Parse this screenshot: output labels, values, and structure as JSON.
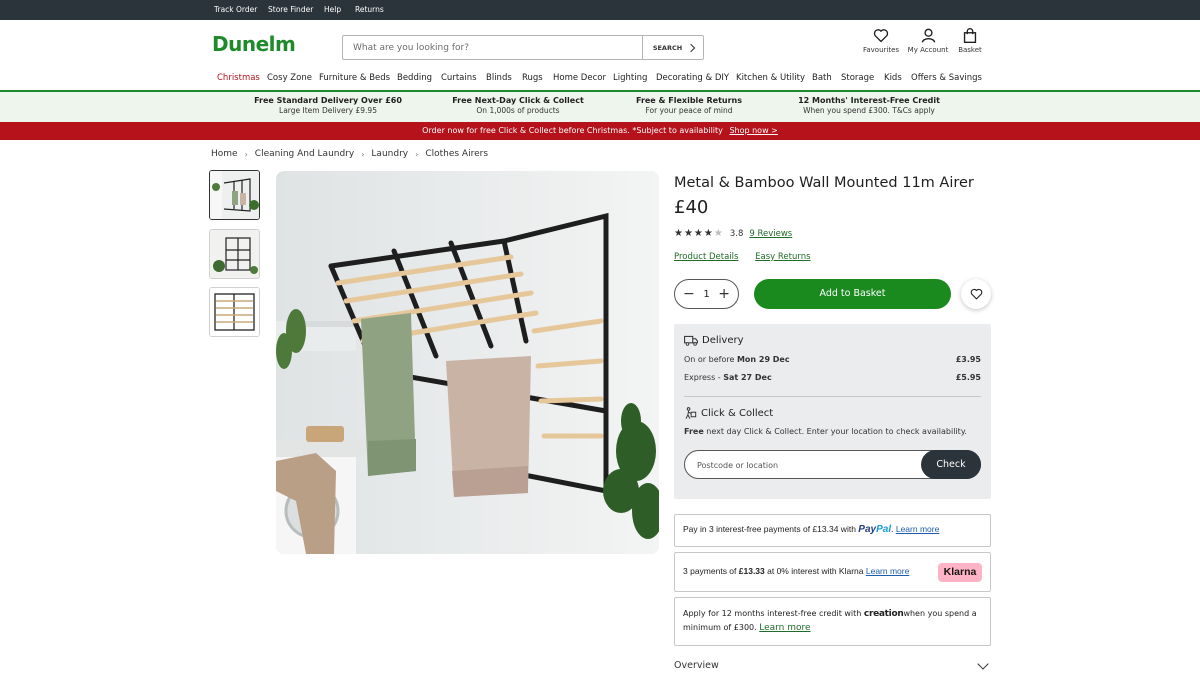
{
  "utility": {
    "links": [
      "Track Order",
      "Store Finder",
      "Help",
      "Returns"
    ]
  },
  "header": {
    "logo": "Dunelm",
    "search_placeholder": "What are you looking for?",
    "search_button": "SEARCH",
    "favourites": "Favourites",
    "account": "My Account",
    "basket": "Basket"
  },
  "nav": {
    "items": [
      "Christmas",
      "Cosy Zone",
      "Furniture & Beds",
      "Bedding",
      "Curtains",
      "Blinds",
      "Rugs",
      "Home Decor",
      "Lighting",
      "Decorating & DIY",
      "Kitchen & Utility",
      "Bath",
      "Storage",
      "Kids",
      "Offers & Savings"
    ]
  },
  "usps": [
    {
      "title": "Free Standard Delivery Over £60",
      "sub": "Large Item Delivery £9.95"
    },
    {
      "title": "Free Next-Day Click & Collect",
      "sub": "On 1,000s of products"
    },
    {
      "title": "Free & Flexible Returns",
      "sub": "For your peace of mind"
    },
    {
      "title": "12 Months' Interest-Free Credit",
      "sub": "When you spend £300. T&Cs apply"
    }
  ],
  "promo": {
    "text": "Order now for free Click & Collect before Christmas. *Subject to availability",
    "link": "Shop now >"
  },
  "breadcrumb": [
    "Home",
    "Cleaning And Laundry",
    "Laundry",
    "Clothes Airers"
  ],
  "product": {
    "title": "Metal & Bamboo Wall Mounted 11m Airer",
    "price": "£40",
    "rating": 3.8,
    "rating_text": "3.8",
    "reviews": "9 Reviews",
    "links": [
      "Product Details",
      "Easy Returns"
    ],
    "quantity": "1",
    "add_button": "Add to Basket"
  },
  "delivery": {
    "heading": "Delivery",
    "rows": [
      {
        "label": "On or before ",
        "date": "Mon 29 Dec",
        "price": "£3.95"
      },
      {
        "label": "Express - ",
        "date": "Sat 27 Dec",
        "price": "£5.95"
      }
    ],
    "cc_heading": "Click & Collect",
    "cc_free": "Free",
    "cc_text": " next day Click & Collect. Enter your location to check availability.",
    "postcode_placeholder": "Postcode or location",
    "check_button": "Check"
  },
  "payments": {
    "paypal_text": "Pay in 3 interest-free payments of £13.34 with ",
    "paypal_logo_pay": "Pay",
    "paypal_logo_pal": "Pal",
    "paypal_link": "Learn more",
    "klarna_text_1": "3 payments of ",
    "klarna_amount": "£13.33",
    "klarna_text_2": " at 0% interest with Klarna ",
    "klarna_link": "Learn more",
    "klarna_badge": "Klarna",
    "credit_text_1": "Apply for 12 months interest-free credit with ",
    "credit_logo": "creation",
    "credit_text_2": "when you spend a minimum of £300. ",
    "credit_link": "Learn more"
  },
  "overview": "Overview",
  "colors": {
    "brand_green": "#1e8a2b",
    "button_green": "#1a8a1f",
    "promo_red": "#b5121b",
    "dark": "#2b333b",
    "klarna_pink": "#ffb3c7"
  }
}
